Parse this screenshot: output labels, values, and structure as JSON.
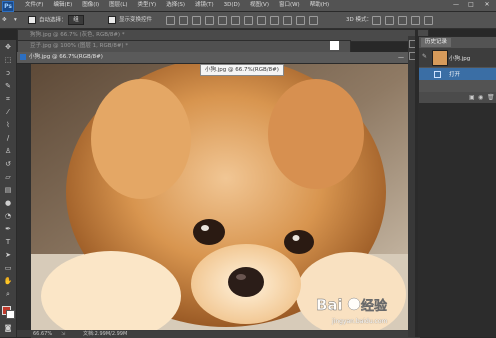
{
  "menubar": {
    "logo": "Ps",
    "items": [
      "文件(F)",
      "编辑(E)",
      "图像(I)",
      "图层(L)",
      "类型(Y)",
      "选择(S)",
      "滤镜(T)",
      "3D(D)",
      "视图(V)",
      "窗口(W)",
      "帮助(H)"
    ],
    "minimize": "—",
    "maximize": "□",
    "close": "✕"
  },
  "options": {
    "auto_select_label": "自动选择：",
    "auto_select_value": "组",
    "show_transform_label": "显示变换控件",
    "mode3d_label": "3D 模式："
  },
  "tabs": [
    {
      "label": "狗狗.jpg @ 66.7% (灰色, RGB/8#) *"
    },
    {
      "label": "豆子.jpg @ 100% (图层 1, RGB/8#) *"
    }
  ],
  "document": {
    "title": "小狗.jpg @ 66.7%(RGB/8#)",
    "tooltip": "小狗.jpg @ 66.7%(RGB/8#)",
    "zoom": "66.67%",
    "doc_size": "文档:2.99M/2.99M"
  },
  "history": {
    "tab": "历史记录",
    "snapshot": "小狗.jpg",
    "step": "打开"
  },
  "watermark": {
    "brand": "Baidu经验",
    "url": "jingyan.baidu.com"
  },
  "colors": {
    "accent": "#3a6ea5",
    "foreground": "#c0392b",
    "background": "#ffffff"
  }
}
